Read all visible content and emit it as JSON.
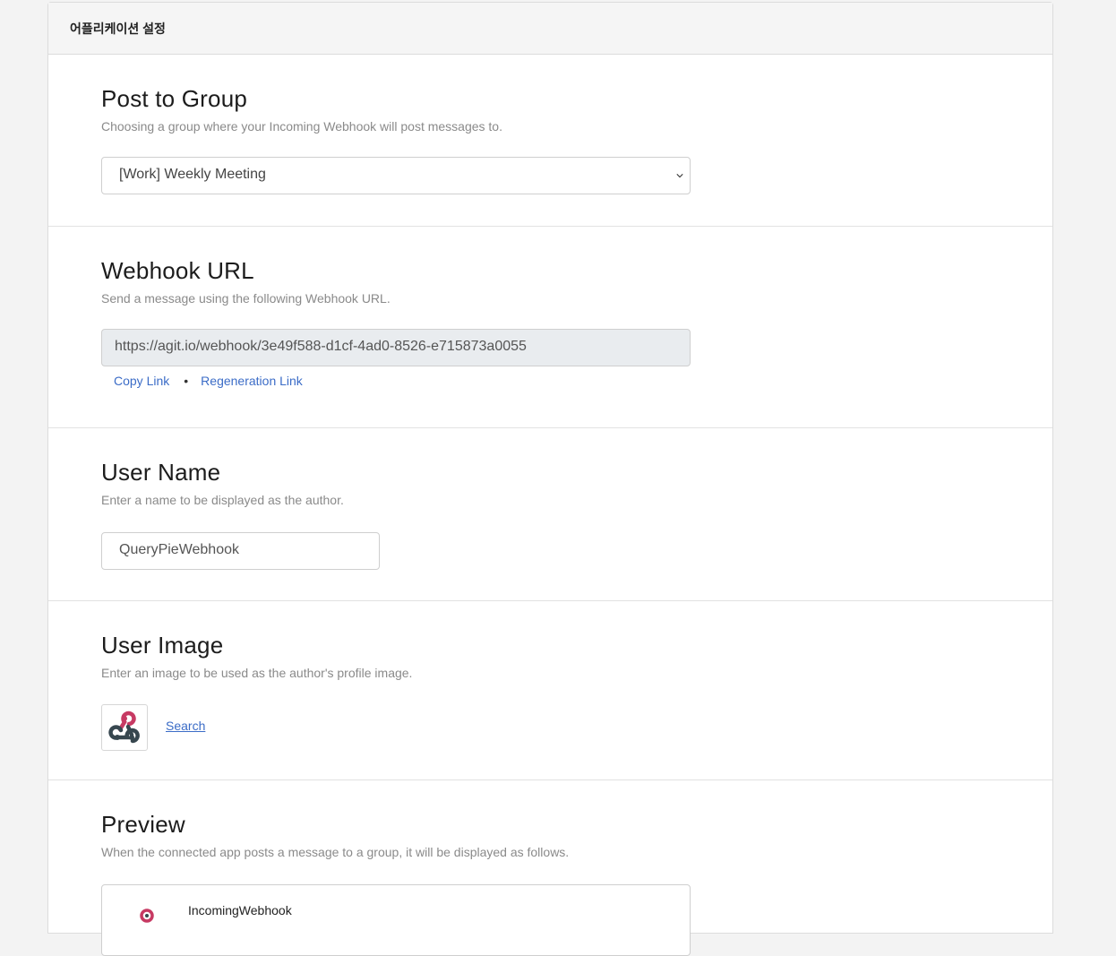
{
  "header": {
    "title": "어플리케이션 설정"
  },
  "post_to_group": {
    "title": "Post to Group",
    "description": "Choosing a group where your Incoming Webhook will post messages to.",
    "selected": "[Work] Weekly Meeting"
  },
  "webhook_url": {
    "title": "Webhook URL",
    "description": "Send a message using the following Webhook URL.",
    "url": "https://agit.io/webhook/3e49f588-d1cf-4ad0-8526-e715873a0055",
    "copy_link": "Copy Link",
    "separator": "•",
    "regeneration_link": "Regeneration Link"
  },
  "user_name": {
    "title": "User Name",
    "description": "Enter a name to be displayed as the author.",
    "value": "QueryPieWebhook"
  },
  "user_image": {
    "title": "User Image",
    "description": "Enter an image to be used as the author's profile image.",
    "icon": "webhook-icon",
    "search_label": "Search"
  },
  "preview": {
    "title": "Preview",
    "description": "When the connected app posts a message to a group, it will be displayed as follows.",
    "author_name": "IncomingWebhook",
    "icon": "webhook-icon"
  },
  "colors": {
    "link": "#3b6cc7",
    "webhook_red": "#c73a63",
    "webhook_dark": "#37474f"
  }
}
